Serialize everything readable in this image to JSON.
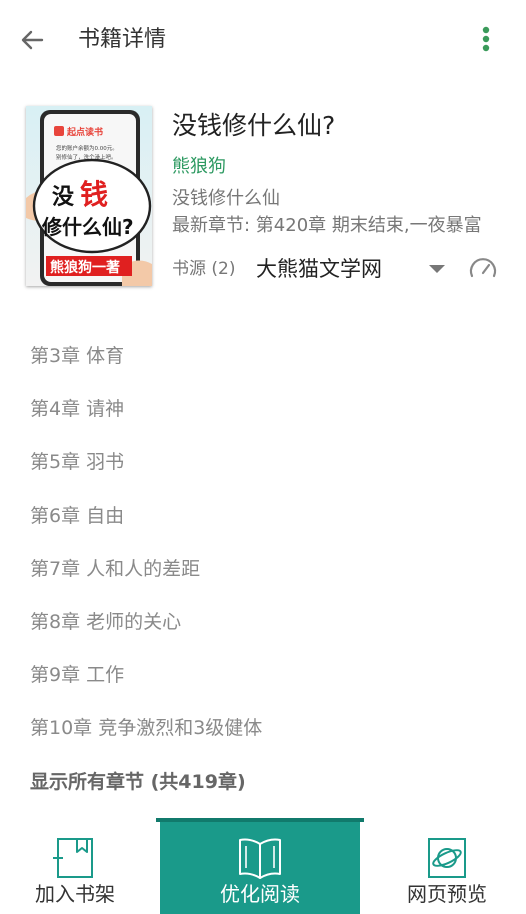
{
  "toolbar": {
    "title": "书籍详情"
  },
  "book": {
    "title": "没钱修什么仙?",
    "author": "熊狼狗",
    "subtitle": "没钱修什么仙",
    "latest_chapter": "最新章节: 第420章 期末结束,一夜暴富",
    "source_label": "书源 (2)",
    "source_value": "大熊猫文学网",
    "cover": {
      "app_badge": "起点读书",
      "msg_line1": "您的账户余额为0.00元。",
      "msg_line2": "别修仙了，洗个澡上吧。",
      "title_char1": "没",
      "title_char2": "钱",
      "title_line2": "修什么仙?",
      "author_banner": "熊狼狗一著"
    }
  },
  "chapters": [
    "第3章 体育",
    "第4章 请神",
    "第5章 羽书",
    "第6章 自由",
    "第7章 人和人的差距",
    "第8章 老师的关心",
    "第9章 工作",
    "第10章 竞争激烈和3级健体"
  ],
  "show_all": "显示所有章节 (共419章)",
  "bottom": {
    "add_shelf": "加入书架",
    "optimized_read": "优化阅读",
    "web_preview": "网页预览"
  },
  "colors": {
    "accent": "#1a9a8a",
    "author_green": "#2e9a62",
    "more_icon": "#3a9a5a"
  }
}
